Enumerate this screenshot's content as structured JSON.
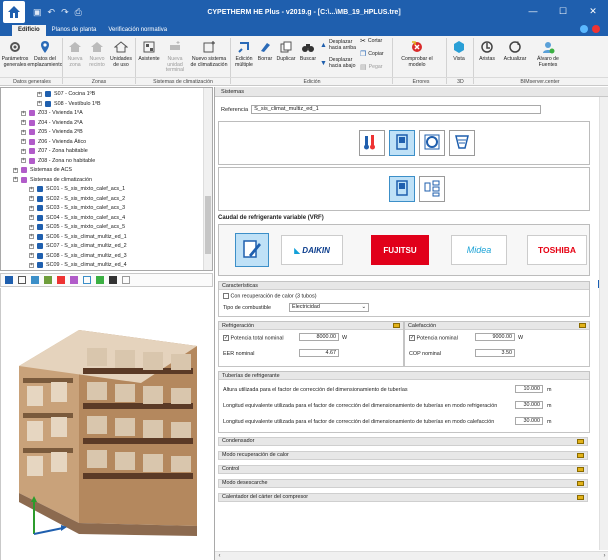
{
  "window": {
    "title": "CYPETHERM HE Plus - v2019.g - [C:\\...\\MB_19_HPLUS.tre]",
    "controls": [
      "—",
      "☐",
      "✕"
    ]
  },
  "tabs": [
    "Edificio",
    "Planos de planta",
    "Verificación normativa"
  ],
  "ribbon": {
    "buttons": {
      "parametros": "Parámetros generales",
      "datos_emplazamiento": "Datos del emplazamiento",
      "nueva_zona": "Nueva zona",
      "nuevo_recinto": "Nuevo recinto",
      "unidades_uso": "Unidades de uso",
      "asistente": "Asistente",
      "nueva_unidad_terminal": "Nueva unidad terminal",
      "nuevo_sistema": "Nuevo sistema de climatización",
      "edicion_multiple": "Edición múltiple",
      "borrar": "Borrar",
      "duplicar": "Duplicar",
      "buscar": "Buscar",
      "desplazar_arriba": "Desplazar hacia arriba",
      "desplazar_abajo": "Desplazar hacia abajo",
      "cortar": "Cortar",
      "copiar": "Copiar",
      "pegar": "Pegar",
      "comprobar": "Comprobar el modelo",
      "vista": "Vista",
      "aristas": "Aristas",
      "actualizar": "Actualizar",
      "alvaro_fuentes": "Álvaro de Fuentes"
    },
    "groups": [
      "Datos generales",
      "Zonas",
      "Sistemas de climatización",
      "Edición",
      "Errores",
      "3D",
      "BIMserver.center"
    ]
  },
  "tree": [
    {
      "label": "S07 - Cocina 1ºB",
      "indent": 4
    },
    {
      "label": "S08 - Vestíbulo 1ºB",
      "indent": 4
    },
    {
      "label": "Z03 - Vivienda 1ºA",
      "indent": 2
    },
    {
      "label": "Z04 - Vivienda 2ºA",
      "indent": 2
    },
    {
      "label": "Z05 - Vivienda 2ºB",
      "indent": 2
    },
    {
      "label": "Z06 - Vivienda Ático",
      "indent": 2
    },
    {
      "label": "Z07 - Zona habitable",
      "indent": 2
    },
    {
      "label": "Z08 - Zona no habitable",
      "indent": 2
    },
    {
      "label": "Sistemas de ACS",
      "indent": 1
    },
    {
      "label": "Sistemas de climatización",
      "indent": 1
    },
    {
      "label": "SC01 - S_sis_mixto_calef_acs_1",
      "indent": 3
    },
    {
      "label": "SC02 - S_sis_mixto_calef_acs_2",
      "indent": 3
    },
    {
      "label": "SC03 - S_sis_mixto_calef_acs_3",
      "indent": 3
    },
    {
      "label": "SC04 - S_sis_mixto_calef_acs_4",
      "indent": 3
    },
    {
      "label": "SC05 - S_sis_mixto_calef_acs_5",
      "indent": 3
    },
    {
      "label": "SC06 - S_sis_climat_multiz_ed_1",
      "indent": 3
    },
    {
      "label": "SC07 - S_sis_climat_multiz_ed_2",
      "indent": 3
    },
    {
      "label": "SC08 - S_sis_climat_multiz_ed_3",
      "indent": 3
    },
    {
      "label": "SC09 - S_sis_climat_multiz_ed_4",
      "indent": 3
    }
  ],
  "main": {
    "header_tab": "Sistemas",
    "referencia_label": "Referencia",
    "referencia_value": "S_sis_climat_multiz_ed_1",
    "vrf_title": "Caudal de refrigerante variable (VRF)",
    "brands": [
      "DAIKIN",
      "FUJITSU",
      "Midea",
      "TOSHIBA"
    ],
    "caracteristicas": {
      "title": "Características",
      "recuperacion_label": "Con recuperación de calor (3 tubos)",
      "combustible_label": "Tipo de combustible",
      "combustible_value": "Electricidad"
    },
    "refrigeracion": {
      "title": "Refrigeración",
      "potencia_label": "Potencia total nominal",
      "potencia_value": "8000.00",
      "potencia_unit": "W",
      "eer_label": "EER nominal",
      "eer_value": "4.67"
    },
    "calefaccion": {
      "title": "Calefacción",
      "potencia_label": "Potencia nominal",
      "potencia_value": "9000.00",
      "potencia_unit": "W",
      "cop_label": "COP nominal",
      "cop_value": "3.50"
    },
    "tuberias": {
      "title": "Tuberías de refrigerante",
      "rows": [
        {
          "label": "Altura utilizada para el factor de corrección del dimensionamiento de tuberías",
          "value": "10.000",
          "unit": "m"
        },
        {
          "label": "Longitud equivalente utilizada para el factor de corrección del dimensionamiento de tuberías en modo refrigeración",
          "value": "30.000",
          "unit": "m"
        },
        {
          "label": "Longitud equivalente utilizada para el factor de corrección del dimensionamiento de tuberías en modo calefacción",
          "value": "30.000",
          "unit": "m"
        }
      ]
    },
    "collapsed_sections": [
      "Condensador",
      "Modo recuperación de calor",
      "Control",
      "Modo desescarche",
      "Calentador del cárter del compresor"
    ]
  }
}
